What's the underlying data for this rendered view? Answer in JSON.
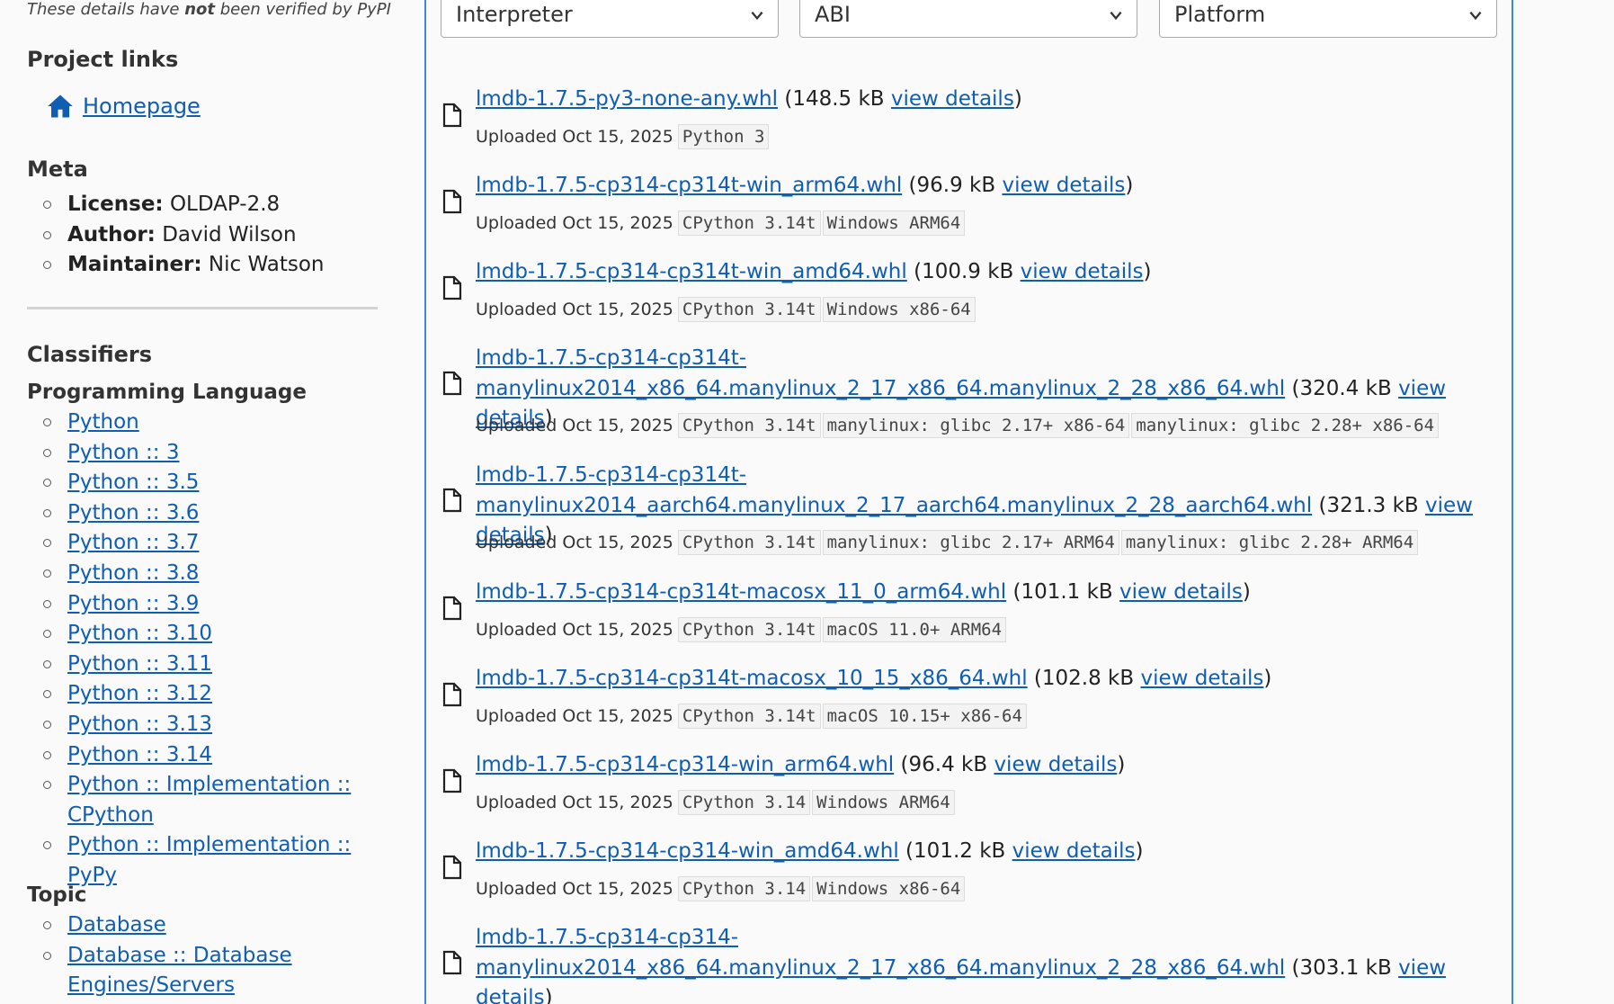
{
  "sidebar": {
    "disclaimer_prefix": "These details have ",
    "disclaimer_bold": "not",
    "disclaimer_suffix": " been verified by PyPI",
    "project_links_title": "Project links",
    "homepage_label": "Homepage",
    "meta_title": "Meta",
    "meta": [
      {
        "key": "License:",
        "value": " OLDAP-2.8"
      },
      {
        "key": "Author:",
        "value": " David Wilson"
      },
      {
        "key": "Maintainer:",
        "value": " Nic Watson"
      }
    ],
    "classifiers_title": "Classifiers",
    "programming_language_title": "Programming Language",
    "programming_language": [
      "Python",
      "Python :: 3",
      "Python :: 3.5",
      "Python :: 3.6",
      "Python :: 3.7",
      "Python :: 3.8",
      "Python :: 3.9",
      "Python :: 3.10",
      "Python :: 3.11",
      "Python :: 3.12",
      "Python :: 3.13",
      "Python :: 3.14",
      "Python :: Implementation :: CPython",
      "Python :: Implementation :: PyPy"
    ],
    "topic_title": "Topic",
    "topic": [
      "Database",
      "Database :: Database Engines/Servers"
    ]
  },
  "filters": {
    "interpreter": "Interpreter",
    "abi": "ABI",
    "platform": "Platform"
  },
  "view_details_label": "view details",
  "files": [
    {
      "name": "lmdb-1.7.5-py3-none-any.whl",
      "size": "148.5 kB",
      "uploaded": "Uploaded Oct 15, 2025",
      "tags": [
        "Python 3"
      ]
    },
    {
      "name": "lmdb-1.7.5-cp314-cp314t-win_arm64.whl",
      "size": "96.9 kB",
      "uploaded": "Uploaded Oct 15, 2025",
      "tags": [
        "CPython 3.14t",
        "Windows ARM64"
      ]
    },
    {
      "name": "lmdb-1.7.5-cp314-cp314t-win_amd64.whl",
      "size": "100.9 kB",
      "uploaded": "Uploaded Oct 15, 2025",
      "tags": [
        "CPython 3.14t",
        "Windows x86-64"
      ]
    },
    {
      "name": "lmdb-1.7.5-cp314-cp314t-manylinux2014_x86_64.manylinux_2_17_x86_64.manylinux_2_28_x86_64.whl",
      "size": "320.4 kB",
      "uploaded": "Uploaded Oct 15, 2025",
      "tags": [
        "CPython 3.14t",
        "manylinux: glibc 2.17+ x86-64",
        "manylinux: glibc 2.28+ x86-64"
      ]
    },
    {
      "name": "lmdb-1.7.5-cp314-cp314t-manylinux2014_aarch64.manylinux_2_17_aarch64.manylinux_2_28_aarch64.whl",
      "size": "321.3 kB",
      "uploaded": "Uploaded Oct 15, 2025",
      "tags": [
        "CPython 3.14t",
        "manylinux: glibc 2.17+ ARM64",
        "manylinux: glibc 2.28+ ARM64"
      ]
    },
    {
      "name": "lmdb-1.7.5-cp314-cp314t-macosx_11_0_arm64.whl",
      "size": "101.1 kB",
      "uploaded": "Uploaded Oct 15, 2025",
      "tags": [
        "CPython 3.14t",
        "macOS 11.0+ ARM64"
      ]
    },
    {
      "name": "lmdb-1.7.5-cp314-cp314t-macosx_10_15_x86_64.whl",
      "size": "102.8 kB",
      "uploaded": "Uploaded Oct 15, 2025",
      "tags": [
        "CPython 3.14t",
        "macOS 10.15+ x86-64"
      ]
    },
    {
      "name": "lmdb-1.7.5-cp314-cp314-win_arm64.whl",
      "size": "96.4 kB",
      "uploaded": "Uploaded Oct 15, 2025",
      "tags": [
        "CPython 3.14",
        "Windows ARM64"
      ]
    },
    {
      "name": "lmdb-1.7.5-cp314-cp314-win_amd64.whl",
      "size": "101.2 kB",
      "uploaded": "Uploaded Oct 15, 2025",
      "tags": [
        "CPython 3.14",
        "Windows x86-64"
      ]
    },
    {
      "name": "lmdb-1.7.5-cp314-cp314-manylinux2014_x86_64.manylinux_2_17_x86_64.manylinux_2_28_x86_64.whl",
      "size": "303.1 kB",
      "uploaded": "",
      "tags": []
    }
  ]
}
